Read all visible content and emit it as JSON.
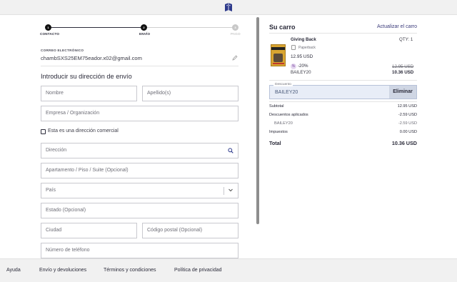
{
  "checkout_steps": [
    {
      "number": "1",
      "label": "CONTACTO"
    },
    {
      "number": "2",
      "label": "ENVÍO"
    },
    {
      "number": "3",
      "label": "PAGO"
    }
  ],
  "contact": {
    "email_label": "CORREO ELECTRÓNICO",
    "email": "chambSXS25EM75eador.x02@gmail.com"
  },
  "shipping": {
    "title": "Introducir su dirección de envío",
    "first_name_placeholder": "Nombre",
    "last_name_placeholder": "Apellido(s)",
    "company_placeholder": "Empresa / Organización",
    "commercial_checkbox_label": "Esta es una dirección comercial",
    "commercial_checked": false,
    "address_placeholder": "Dirección",
    "apartment_placeholder": "Apartamento / Piso / Suite (Opcional)",
    "country_placeholder": "País",
    "state_placeholder": "Estado (Opcional)",
    "city_placeholder": "Ciudad",
    "postal_placeholder": "Código postal (Opcional)",
    "phone_placeholder": "Número de teléfono"
  },
  "cart": {
    "title": "Su carro",
    "update_link": "Actualizar el carro",
    "item": {
      "title": "Giving Back",
      "qty": "QTY: 1",
      "format": "Paperback",
      "price": "12.95 USD",
      "discount_pct": "-20%",
      "discount_code": "BAILEY20",
      "original_price": "12.95 USD",
      "discounted_price": "10.36 USD"
    },
    "coupon": {
      "legend": "Descuento",
      "value": "BAILEY20",
      "remove_label": "Eliminar"
    },
    "summary": {
      "subtotal_label": "Subtotal",
      "subtotal_value": "12.95 USD",
      "discounts_label": "Descuentos aplicados",
      "discounts_value": "-2.59 USD",
      "discount_code_label": "BAILEY20",
      "discount_code_value": "-2.59 USD",
      "taxes_label": "Impuestos",
      "taxes_value": "0.00 USD",
      "total_label": "Total",
      "total_value": "10.36 USD"
    }
  },
  "footer": {
    "help": "Ayuda",
    "shipping_returns": "Envío y devoluciones",
    "terms": "Términos y condiciones",
    "privacy": "Política de privacidad"
  },
  "colors": {
    "accent": "#2b2b3a",
    "link": "#3a3a7a",
    "coupon_bg": "#e8edf7",
    "book_cover": "#d9a531"
  },
  "icons": {
    "logo": "book-logo-icon",
    "edit": "pencil-icon",
    "search": "search-icon",
    "dropdown": "chevron-down-icon",
    "format": "book-icon",
    "discount": "percent-icon"
  }
}
